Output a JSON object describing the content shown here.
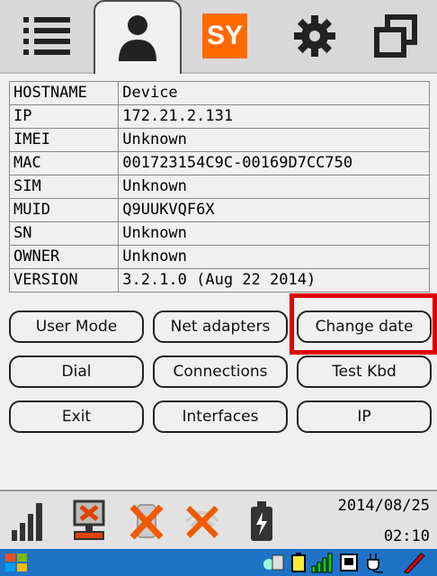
{
  "tabs": [
    {
      "name": "list-icon"
    },
    {
      "name": "person-icon",
      "active": true
    },
    {
      "name": "sy-logo",
      "label": "SY"
    },
    {
      "name": "gear-icon"
    },
    {
      "name": "windows-icon"
    }
  ],
  "info_rows": [
    {
      "key": "HOSTNAME",
      "value": "Device"
    },
    {
      "key": "IP",
      "value": "172.21.2.131"
    },
    {
      "key": "IMEI",
      "value": "Unknown"
    },
    {
      "key": "MAC",
      "value": "001723154C9C-00169D7CC750"
    },
    {
      "key": "SIM",
      "value": "Unknown"
    },
    {
      "key": "MUID",
      "value": "Q9UUKVQF6X"
    },
    {
      "key": "SN",
      "value": "Unknown"
    },
    {
      "key": "OWNER",
      "value": "Unknown"
    },
    {
      "key": "VERSION",
      "value": "3.2.1.0 (Aug 22 2014)"
    }
  ],
  "buttons": {
    "user_mode": "User Mode",
    "net_adapters": "Net adapters",
    "change_date": "Change date",
    "dial": "Dial",
    "connections": "Connections",
    "test_kbd": "Test Kbd",
    "exit": "Exit",
    "interfaces": "Interfaces",
    "ip": "IP"
  },
  "status": {
    "date": "2014/08/25",
    "time": "02:10",
    "icons": [
      "signal-icon",
      "network-error-icon",
      "phone-disabled-icon",
      "wireless-disabled-icon",
      "battery-icon"
    ]
  },
  "taskbar": {
    "icons": [
      "windows-start-icon",
      "network-icon",
      "battery-icon",
      "signal-icon",
      "keyboard-icon",
      "power-icon",
      "pen-icon"
    ]
  },
  "colors": {
    "highlight": "#e10000",
    "taskbar": "#1e73c9",
    "sy_logo": "#ff6a00"
  }
}
